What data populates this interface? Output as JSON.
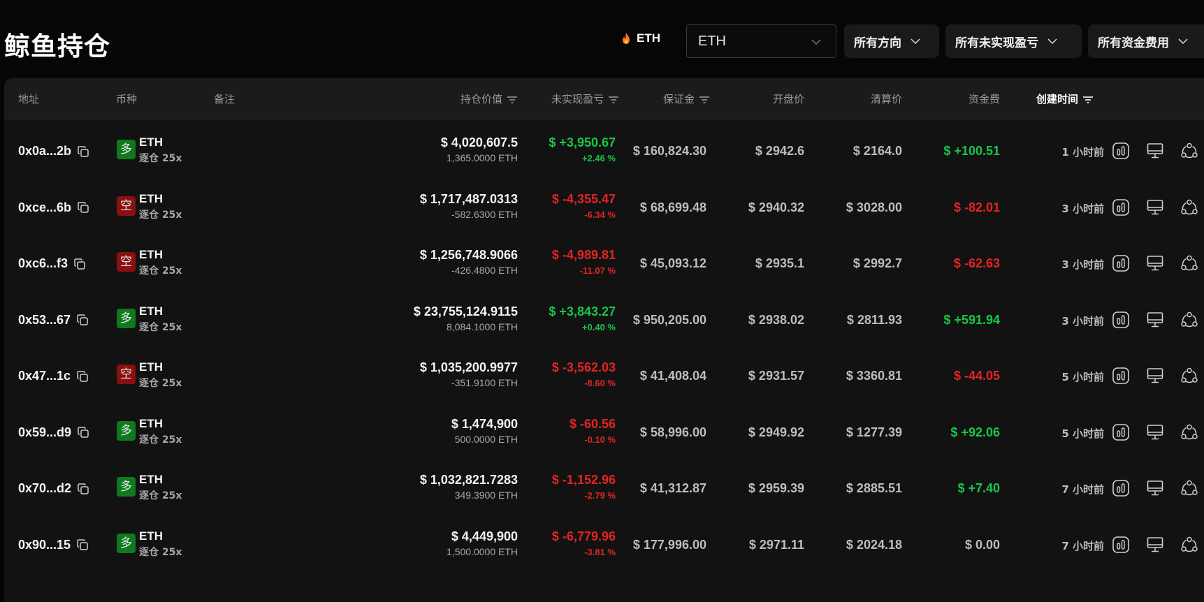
{
  "header": {
    "title": "鲸鱼持仓",
    "token_badge": "ETH",
    "coin_select": "ETH",
    "direction_filter": "所有方向",
    "pnl_filter": "所有未实现盈亏",
    "funding_filter": "所有资金费用"
  },
  "columns": {
    "address": "地址",
    "coin": "币种",
    "note": "备注",
    "position_value": "持仓价值",
    "unrealized_pnl": "未实现盈亏",
    "margin": "保证金",
    "open_price": "开盘价",
    "liq_price": "清算价",
    "funding": "资金费",
    "created": "创建时间"
  },
  "colors": {
    "positive": "#18c64a",
    "negative": "#e32424",
    "long_badge": "#0e7a1d",
    "short_badge": "#8a1010"
  },
  "rows": [
    {
      "address": "0x0a...2b",
      "side": "多",
      "side_type": "long",
      "coin": "ETH",
      "mode": "逐仓 25x",
      "value": "$ 4,020,607.5",
      "qty": "1,365.0000 ETH",
      "pnl": "$ +3,950.67",
      "pnl_pct": "+2.46 %",
      "pnl_sign": "pos",
      "margin": "$ 160,824.30",
      "open": "$ 2942.6",
      "liq": "$ 2164.0",
      "funding": "$ +100.51",
      "funding_sign": "pos",
      "time": "1 小时前"
    },
    {
      "address": "0xce...6b",
      "side": "空",
      "side_type": "short",
      "coin": "ETH",
      "mode": "逐仓 25x",
      "value": "$ 1,717,487.0313",
      "qty": "-582.6300 ETH",
      "pnl": "$ -4,355.47",
      "pnl_pct": "-6.34 %",
      "pnl_sign": "neg",
      "margin": "$ 68,699.48",
      "open": "$ 2940.32",
      "liq": "$ 3028.00",
      "funding": "$ -82.01",
      "funding_sign": "neg",
      "time": "3 小时前"
    },
    {
      "address": "0xc6...f3",
      "side": "空",
      "side_type": "short",
      "coin": "ETH",
      "mode": "逐仓 25x",
      "value": "$ 1,256,748.9066",
      "qty": "-426.4800 ETH",
      "pnl": "$ -4,989.81",
      "pnl_pct": "-11.07 %",
      "pnl_sign": "neg",
      "margin": "$ 45,093.12",
      "open": "$ 2935.1",
      "liq": "$ 2992.7",
      "funding": "$ -62.63",
      "funding_sign": "neg",
      "time": "3 小时前"
    },
    {
      "address": "0x53...67",
      "side": "多",
      "side_type": "long",
      "coin": "ETH",
      "mode": "逐仓 25x",
      "value": "$ 23,755,124.9115",
      "qty": "8,084.1000 ETH",
      "pnl": "$ +3,843.27",
      "pnl_pct": "+0.40 %",
      "pnl_sign": "pos",
      "margin": "$ 950,205.00",
      "open": "$ 2938.02",
      "liq": "$ 2811.93",
      "funding": "$ +591.94",
      "funding_sign": "pos",
      "time": "3 小时前"
    },
    {
      "address": "0x47...1c",
      "side": "空",
      "side_type": "short",
      "coin": "ETH",
      "mode": "逐仓 25x",
      "value": "$ 1,035,200.9977",
      "qty": "-351.9100 ETH",
      "pnl": "$ -3,562.03",
      "pnl_pct": "-8.60 %",
      "pnl_sign": "neg",
      "margin": "$ 41,408.04",
      "open": "$ 2931.57",
      "liq": "$ 3360.81",
      "funding": "$ -44.05",
      "funding_sign": "neg",
      "time": "5 小时前"
    },
    {
      "address": "0x59...d9",
      "side": "多",
      "side_type": "long",
      "coin": "ETH",
      "mode": "逐仓 25x",
      "value": "$ 1,474,900",
      "qty": "500.0000 ETH",
      "pnl": "$ -60.56",
      "pnl_pct": "-0.10 %",
      "pnl_sign": "neg",
      "margin": "$ 58,996.00",
      "open": "$ 2949.92",
      "liq": "$ 1277.39",
      "funding": "$ +92.06",
      "funding_sign": "pos",
      "time": "5 小时前"
    },
    {
      "address": "0x70...d2",
      "side": "多",
      "side_type": "long",
      "coin": "ETH",
      "mode": "逐仓 25x",
      "value": "$ 1,032,821.7283",
      "qty": "349.3900 ETH",
      "pnl": "$ -1,152.96",
      "pnl_pct": "-2.79 %",
      "pnl_sign": "neg",
      "margin": "$ 41,312.87",
      "open": "$ 2959.39",
      "liq": "$ 2885.51",
      "funding": "$ +7.40",
      "funding_sign": "pos",
      "time": "7 小时前"
    },
    {
      "address": "0x90...15",
      "side": "多",
      "side_type": "long",
      "coin": "ETH",
      "mode": "逐仓 25x",
      "value": "$ 4,449,900",
      "qty": "1,500.0000 ETH",
      "pnl": "$ -6,779.96",
      "pnl_pct": "-3.81 %",
      "pnl_sign": "neg",
      "margin": "$ 177,996.00",
      "open": "$ 2971.11",
      "liq": "$ 2024.18",
      "funding": "$ 0.00",
      "funding_sign": "zero",
      "time": "7 小时前"
    }
  ]
}
